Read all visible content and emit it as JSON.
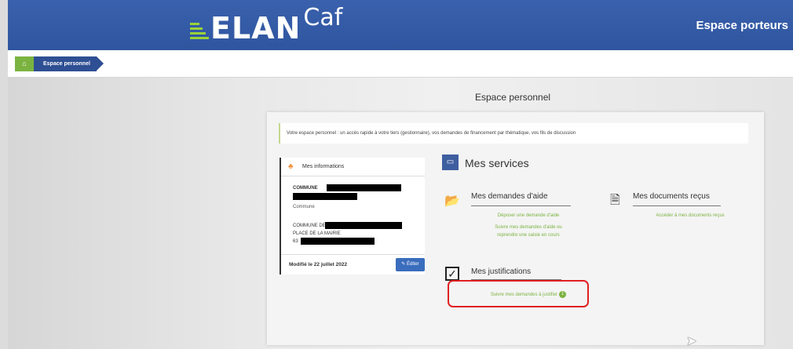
{
  "header": {
    "logo_main": "ELAN",
    "logo_suffix": "Caf",
    "space_label": "Espace porteurs"
  },
  "breadcrumb": {
    "home_icon": "home-icon",
    "items": [
      "Espace personnel"
    ]
  },
  "page": {
    "title": "Espace personnel",
    "intro": "Votre espace personnel : un accès rapide à votre tiers (gestionnaire), vos demandes de financement par thématique, vos fils de discussion"
  },
  "info_card": {
    "title": "Mes informations",
    "name_prefix": "COMMUNE",
    "type": "Commune",
    "address_line1_prefix": "COMMUNE DE",
    "address_line2": "PLACE DE LA MAIRIE",
    "postcode_prefix": "63",
    "modified": "Modifié le 22 juillet 2022",
    "edit_label": "Éditer"
  },
  "services": {
    "title": "Mes services",
    "aid_requests": {
      "title": "Mes demandes d'aide",
      "links": [
        "Déposer une demande d'aide",
        "Suivre mes demandes d'aide ou",
        "reprendre une saisie en cours"
      ]
    },
    "documents": {
      "title": "Mes documents reçus",
      "links": [
        "Accéder à mes documents reçus"
      ]
    },
    "justifications": {
      "title": "Mes justifications",
      "link": "Suivre mes demandes à justifier",
      "count": "1"
    }
  },
  "colors": {
    "header_blue": "#2f559f",
    "logo_green": "#9ad238",
    "link_green": "#7bb340",
    "highlight_red": "#e02020"
  }
}
